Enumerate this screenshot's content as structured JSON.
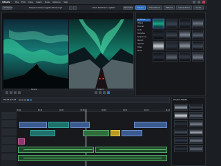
{
  "app": {
    "title": "VEGAS",
    "menu_items": [
      "File",
      "Edit",
      "View",
      "Insert",
      "Tools",
      "Options",
      "Help"
    ]
  },
  "toolbar": {
    "left_label": "Workspace",
    "preview_title": "Prepare Green Lights 2019.veg*",
    "program_title": "Dark Northern Lights*",
    "right_label": "Resolution"
  },
  "media_pool": {
    "tabs": [
      "Media",
      "Transitions",
      "Effects",
      "Generators",
      "Audio",
      "Media FX"
    ],
    "folders": [
      "All Media",
      "Videos",
      "Pictures",
      "Audio",
      "Favorites",
      "Sequences",
      "Recent",
      "Imports",
      "Titles",
      "Music"
    ]
  },
  "preview": {
    "left_label": "Source",
    "right_label": "Program"
  },
  "timeline": {
    "timecode": "00:01:23:12",
    "ruler_marks": [
      "00:00",
      "00:10",
      "00:20",
      "00:30",
      "00:40",
      "00:50",
      "01:00",
      "01:10"
    ]
  },
  "right_panel": {
    "title": "Project Media"
  },
  "colors": {
    "accent": "#2e6fbf",
    "background": "#1b1e23",
    "panel": "#15171b"
  }
}
